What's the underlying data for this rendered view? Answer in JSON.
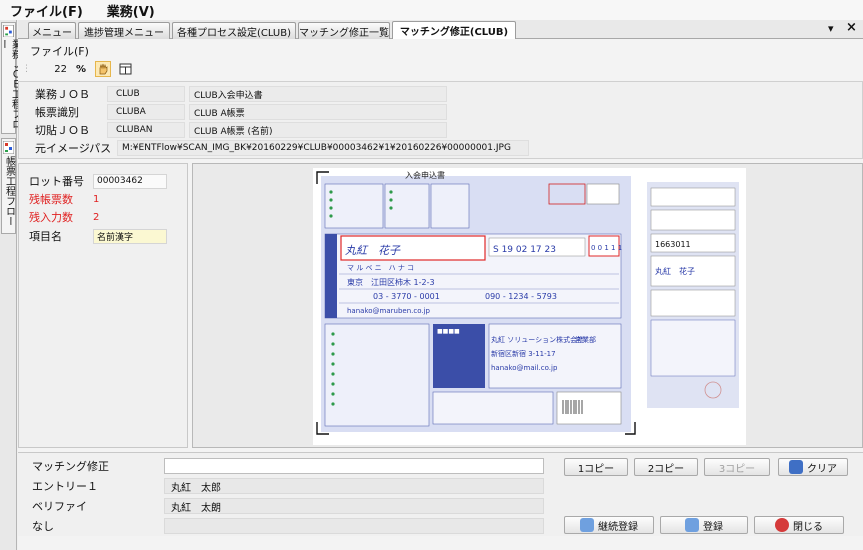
{
  "menubar": {
    "file": "ファイル(F)",
    "business": "業務(V)"
  },
  "sidetabs": {
    "tab1": "業務ＪＯＢ工程フロー",
    "tab2": "帳票工程フロー"
  },
  "tabs": [
    {
      "label": "メニュー"
    },
    {
      "label": "進捗管理メニュー"
    },
    {
      "label": "各種プロセス設定(CLUB)"
    },
    {
      "label": "マッチング修正一覧"
    },
    {
      "label": "マッチング修正(CLUB)"
    }
  ],
  "tab_controls": {
    "dropdown": "▾",
    "close": "×"
  },
  "panel": {
    "file_menu": "ファイル(F)",
    "zoom": "22",
    "zoom_unit": "%"
  },
  "info": {
    "job_label": "業務ＪＯＢ",
    "job_code": "CLUB",
    "job_name": "CLUB入会申込書",
    "form_label": "帳票識別",
    "form_code": "CLUBA",
    "form_name": "CLUB A帳票",
    "cut_label": "切貼ＪＯＢ",
    "cut_code": "CLUBAN",
    "cut_name": "CLUB A帳票 (名前)",
    "path_label": "元イメージパス",
    "path_value": "M:¥ENTFlow¥SCAN_IMG_BK¥20160229¥CLUB¥00003462¥1¥20160226¥00000001.JPG"
  },
  "left": {
    "lot_label": "ロット番号",
    "lot_value": "00003462",
    "remain_forms_label": "残帳票数",
    "remain_forms_value": "1",
    "remain_input_label": "残入力数",
    "remain_input_value": "2",
    "item_label": "項目名",
    "item_value": "名前漢字"
  },
  "document": {
    "title": "入会申込書",
    "name_hw": "丸紅　花子",
    "kana_hw": "マ ル ベ ニ　ハ ナ コ",
    "birth_hw": "S 19 02 17 23",
    "code_hw": "0 0 1 1 1",
    "addr_hw": "東京　江田区柿木 1-2-3",
    "tel_hw": "03 - 3770 - 0001",
    "mobile_hw": "090 - 1234 - 5793",
    "mail_hw": "hanako@maruben.co.jp",
    "company_hw": "丸紅 ソリューション株式会社",
    "caddr_hw": "新宿区新宿 3-11-17",
    "cmail_hw": "hanako@mail.co.jp",
    "dept_hw": "営業部",
    "right_code_hw": "1663011",
    "right_name_hw": "丸紅　花子"
  },
  "bottom": {
    "match_label": "マッチング修正",
    "match_value": "",
    "entry_label": "エントリー１",
    "entry_value": "丸紅　太郎",
    "verify_label": "ベリファイ",
    "verify_value": "丸紅　太朗",
    "none_label": "なし",
    "none_value": "",
    "copy1": "1コピー",
    "copy2": "2コピー",
    "copy3": "3コピー",
    "clear": "クリア",
    "continue_reg": "継続登録",
    "register": "登録",
    "close": "閉じる"
  }
}
